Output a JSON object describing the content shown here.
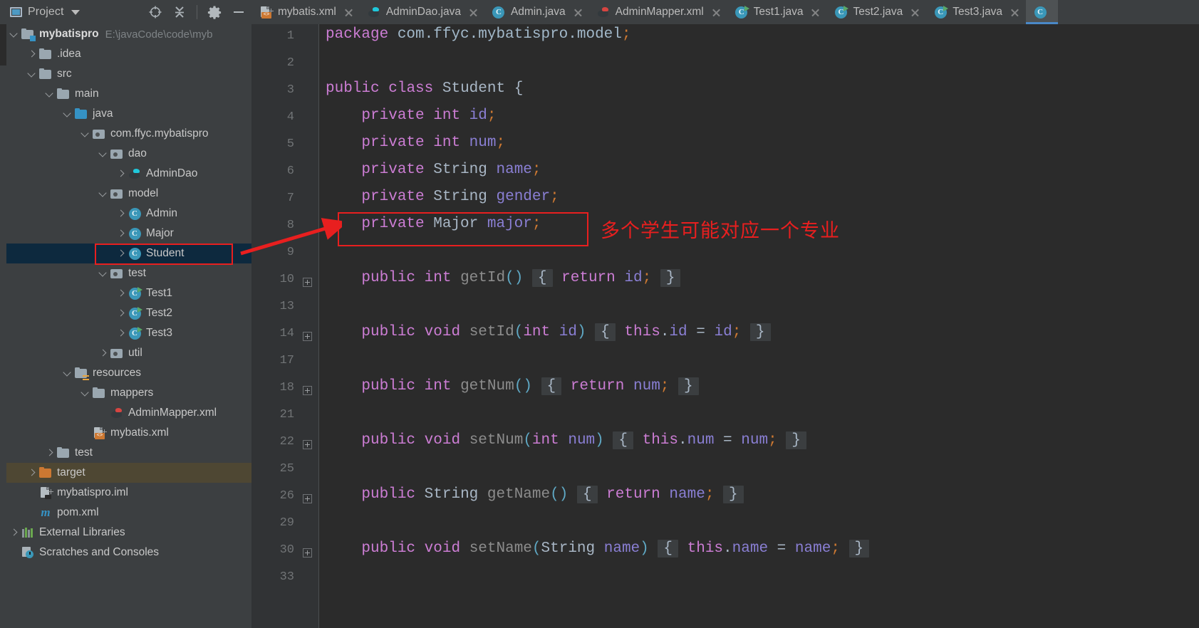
{
  "window": {
    "bg": "#3c3f41",
    "editor_bg": "#2b2b2b",
    "accent": "#4a88c7",
    "annotation_color": "#e81f1f"
  },
  "project_panel": {
    "title": "Project",
    "toolbar_icons": [
      "locate-icon",
      "collapse-all-icon",
      "settings-icon",
      "minimize-icon"
    ],
    "tree": [
      {
        "depth": 0,
        "arrow": "down",
        "icon": "module-folder-icon",
        "label": "mybatispro",
        "bold": true,
        "path": "E:\\javaCode\\code\\myb"
      },
      {
        "depth": 1,
        "arrow": "right",
        "icon": "folder-icon",
        "label": ".idea"
      },
      {
        "depth": 1,
        "arrow": "down",
        "icon": "folder-icon",
        "label": "src"
      },
      {
        "depth": 2,
        "arrow": "down",
        "icon": "folder-icon",
        "label": "main"
      },
      {
        "depth": 3,
        "arrow": "down",
        "icon": "source-folder-icon",
        "label": "java"
      },
      {
        "depth": 4,
        "arrow": "down",
        "icon": "package-icon",
        "label": "com.ffyc.mybatispro"
      },
      {
        "depth": 5,
        "arrow": "down",
        "icon": "package-icon",
        "label": "dao"
      },
      {
        "depth": 6,
        "arrow": "right",
        "icon": "mybatis-interface-icon",
        "label": "AdminDao"
      },
      {
        "depth": 5,
        "arrow": "down",
        "icon": "package-icon",
        "label": "model"
      },
      {
        "depth": 6,
        "arrow": "right",
        "icon": "class-icon",
        "label": "Admin"
      },
      {
        "depth": 6,
        "arrow": "right",
        "icon": "class-icon",
        "label": "Major"
      },
      {
        "depth": 6,
        "arrow": "right",
        "icon": "class-icon",
        "label": "Student",
        "selected": true,
        "highlighted": true
      },
      {
        "depth": 5,
        "arrow": "down",
        "icon": "package-icon",
        "label": "test"
      },
      {
        "depth": 6,
        "arrow": "right",
        "icon": "runnable-class-icon",
        "label": "Test1"
      },
      {
        "depth": 6,
        "arrow": "right",
        "icon": "runnable-class-icon",
        "label": "Test2"
      },
      {
        "depth": 6,
        "arrow": "right",
        "icon": "runnable-class-icon",
        "label": "Test3"
      },
      {
        "depth": 5,
        "arrow": "right",
        "icon": "package-icon",
        "label": "util"
      },
      {
        "depth": 3,
        "arrow": "down",
        "icon": "resources-folder-icon",
        "label": "resources"
      },
      {
        "depth": 4,
        "arrow": "down",
        "icon": "folder-icon",
        "label": "mappers"
      },
      {
        "depth": 5,
        "arrow": "none",
        "icon": "mybatis-mapper-icon",
        "label": "AdminMapper.xml"
      },
      {
        "depth": 4,
        "arrow": "none",
        "icon": "xml-file-icon",
        "label": "mybatis.xml"
      },
      {
        "depth": 2,
        "arrow": "right",
        "icon": "folder-icon",
        "label": "test"
      },
      {
        "depth": 1,
        "arrow": "right",
        "icon": "excluded-folder-icon",
        "label": "target",
        "target_row": true
      },
      {
        "depth": 1,
        "arrow": "none",
        "icon": "iml-file-icon",
        "label": "mybatispro.iml"
      },
      {
        "depth": 1,
        "arrow": "none",
        "icon": "maven-icon",
        "label": "pom.xml"
      },
      {
        "depth": 0,
        "arrow": "right",
        "icon": "external-libraries-icon",
        "label": "External Libraries"
      },
      {
        "depth": 0,
        "arrow": "none",
        "icon": "scratches-icon",
        "label": "Scratches and Consoles"
      }
    ]
  },
  "editor": {
    "tabs": [
      {
        "label": "mybatis.xml",
        "icon": "xml-file-icon",
        "active": false
      },
      {
        "label": "AdminDao.java",
        "icon": "mybatis-bird-icon",
        "active": false
      },
      {
        "label": "Admin.java",
        "icon": "class-icon",
        "active": false
      },
      {
        "label": "AdminMapper.xml",
        "icon": "mybatis-red-bird-icon",
        "active": false
      },
      {
        "label": "Test1.java",
        "icon": "runnable-class-icon",
        "active": false
      },
      {
        "label": "Test2.java",
        "icon": "runnable-class-icon",
        "active": false
      },
      {
        "label": "Test3.java",
        "icon": "runnable-class-icon",
        "active": false
      },
      {
        "label": "",
        "icon": "class-icon",
        "active": true
      }
    ],
    "line_numbers": [
      "1",
      "2",
      "3",
      "4",
      "5",
      "6",
      "7",
      "8",
      "9",
      "10",
      "13",
      "14",
      "17",
      "18",
      "21",
      "22",
      "25",
      "26",
      "29",
      "30",
      "33"
    ],
    "fold_markers_on_lines": [
      "10",
      "14",
      "18",
      "22",
      "26",
      "30"
    ],
    "code_lines": [
      {
        "num": "1",
        "text": "package com.ffyc.mybatispro.model;"
      },
      {
        "num": "2",
        "text": ""
      },
      {
        "num": "3",
        "text": "public class Student {"
      },
      {
        "num": "4",
        "text": "    private int id;"
      },
      {
        "num": "5",
        "text": "    private int num;"
      },
      {
        "num": "6",
        "text": "    private String name;"
      },
      {
        "num": "7",
        "text": "    private String gender;"
      },
      {
        "num": "8",
        "text": "    private Major major;"
      },
      {
        "num": "9",
        "text": ""
      },
      {
        "num": "10",
        "text": "    public int getId() { return id; }"
      },
      {
        "num": "13",
        "text": ""
      },
      {
        "num": "14",
        "text": "    public void setId(int id) { this.id = id; }"
      },
      {
        "num": "17",
        "text": ""
      },
      {
        "num": "18",
        "text": "    public int getNum() { return num; }"
      },
      {
        "num": "21",
        "text": ""
      },
      {
        "num": "22",
        "text": "    public void setNum(int num) { this.num = num; }"
      },
      {
        "num": "25",
        "text": ""
      },
      {
        "num": "26",
        "text": "    public String getName() { return name; }"
      },
      {
        "num": "29",
        "text": ""
      },
      {
        "num": "30",
        "text": "    public void setName(String name) { this.name = name; }"
      },
      {
        "num": "33",
        "text": ""
      }
    ]
  },
  "annotations": {
    "chinese_note": "多个学生可能对应一个专业",
    "box_around_code_line": "private Major major;",
    "box_around_tree_item": "Student",
    "arrow": "red-arrow-pointing-right"
  }
}
